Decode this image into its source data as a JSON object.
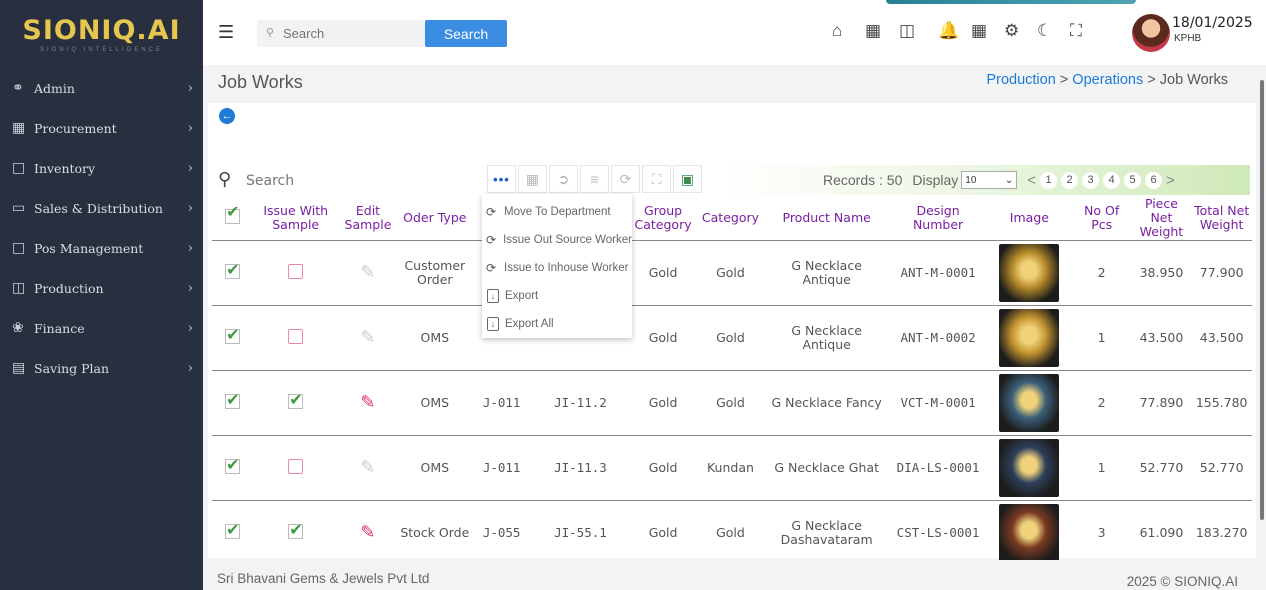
{
  "brand": {
    "name": "SIONIQ.AI",
    "tagline": "SIONIQ INTELLIGENCE"
  },
  "sidebar": {
    "items": [
      {
        "label": "Admin",
        "icon": "admin-icon"
      },
      {
        "label": "Procurement",
        "icon": "procurement-icon"
      },
      {
        "label": "Inventory",
        "icon": "inventory-icon"
      },
      {
        "label": "Sales & Distribution",
        "icon": "sales-icon"
      },
      {
        "label": "Pos Management",
        "icon": "pos-icon"
      },
      {
        "label": "Production",
        "icon": "production-icon"
      },
      {
        "label": "Finance",
        "icon": "finance-icon"
      },
      {
        "label": "Saving Plan",
        "icon": "saving-plan-icon"
      }
    ]
  },
  "topbar": {
    "search_placeholder": "Search",
    "search_button": "Search",
    "user_date": "18/01/2025",
    "user_branch": "KPHB"
  },
  "page": {
    "title": "Job Works",
    "breadcrumb": {
      "item1": "Production",
      "sep": ">",
      "item2": "Operations",
      "item3": "Job Works"
    }
  },
  "grid_toolbar": {
    "search_placeholder": "Search",
    "records": "Records : 50",
    "display_label": "Display",
    "display_value": "10",
    "pages": [
      "1",
      "2",
      "3",
      "4",
      "5",
      "6"
    ]
  },
  "more_menu": {
    "items": [
      "Move To Department",
      "Issue Out Source Worker",
      "Issue to Inhouse Worker",
      "Export",
      "Export All"
    ]
  },
  "table": {
    "headers": {
      "issue_with_sample": "Issue With Sample",
      "edit_sample": "Edit Sample",
      "order_type": "Oder Type",
      "job_no": "",
      "job_item": "",
      "group_category": "Group Category",
      "category": "Category",
      "product_name": "Product Name",
      "design_number": "Design Number",
      "image": "Image",
      "no_of_pcs": "No Of Pcs",
      "piece_net_weight": "Piece Net Weight",
      "total_net_weight": "Total Net Weight"
    },
    "rows": [
      {
        "selected": true,
        "issue_with_sample": false,
        "edit_enabled": false,
        "order_type": "Customer Order",
        "job_no": "",
        "job_item": "",
        "group": "Gold",
        "category": "Gold",
        "product": "G Necklace Antique",
        "design": "ANT-M-0001",
        "pcs": "2",
        "piece_wt": "38.950",
        "total_wt": "77.900",
        "thumb_color": "#b58a2a"
      },
      {
        "selected": true,
        "issue_with_sample": false,
        "edit_enabled": false,
        "order_type": "OMS",
        "job_no": "",
        "job_item": "",
        "group": "Gold",
        "category": "Gold",
        "product": "G Necklace Antique",
        "design": "ANT-M-0002",
        "pcs": "1",
        "piece_wt": "43.500",
        "total_wt": "43.500",
        "thumb_color": "#c49530"
      },
      {
        "selected": true,
        "issue_with_sample": true,
        "edit_enabled": true,
        "order_type": "OMS",
        "job_no": "J-011",
        "job_item": "JI-11.2",
        "group": "Gold",
        "category": "Gold",
        "product": "G Necklace Fancy",
        "design": "VCT-M-0001",
        "pcs": "2",
        "piece_wt": "77.890",
        "total_wt": "155.780",
        "thumb_color": "#3c5f7a"
      },
      {
        "selected": true,
        "issue_with_sample": false,
        "edit_enabled": false,
        "order_type": "OMS",
        "job_no": "J-011",
        "job_item": "JI-11.3",
        "group": "Gold",
        "category": "Kundan",
        "product": "G Necklace Ghat",
        "design": "DIA-LS-0001",
        "pcs": "1",
        "piece_wt": "52.770",
        "total_wt": "52.770",
        "thumb_color": "#2e3f5a"
      },
      {
        "selected": true,
        "issue_with_sample": true,
        "edit_enabled": true,
        "order_type": "Stock Orde",
        "job_no": "J-055",
        "job_item": "JI-55.1",
        "group": "Gold",
        "category": "Gold",
        "product": "G Necklace Dashavataram",
        "design": "CST-LS-0001",
        "pcs": "3",
        "piece_wt": "61.090",
        "total_wt": "183.270",
        "thumb_color": "#7a3a22"
      }
    ]
  },
  "footer": {
    "company": "Sri Bhavani Gems & Jewels Pvt Ltd",
    "copyright": "2025 © SIONIQ.AI"
  },
  "colors": {
    "sidebar_bg": "#283040",
    "accent": "#1e7bd4",
    "header_text": "#7a1fa2",
    "brand": "#e7c64f"
  }
}
